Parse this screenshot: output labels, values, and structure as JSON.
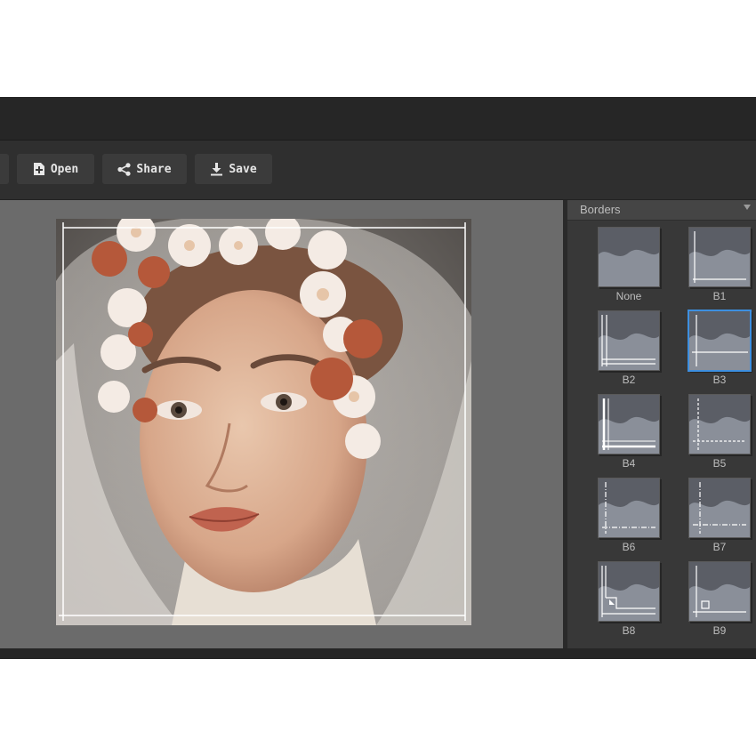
{
  "toolbar": {
    "buttons": [
      {
        "label": "Open",
        "icon": "file-plus-icon"
      },
      {
        "label": "Share",
        "icon": "share-icon"
      },
      {
        "label": "Save",
        "icon": "download-icon"
      }
    ]
  },
  "canvas": {
    "image": "portrait-photo",
    "border_style": "B3"
  },
  "panel": {
    "title": "Borders",
    "items": [
      {
        "label": "None"
      },
      {
        "label": "B1"
      },
      {
        "label": "B2"
      },
      {
        "label": "B3",
        "selected": true
      },
      {
        "label": "B4"
      },
      {
        "label": "B5"
      },
      {
        "label": "B6"
      },
      {
        "label": "B7"
      },
      {
        "label": "B8"
      },
      {
        "label": "B9"
      }
    ]
  },
  "colors": {
    "accent": "#3d8fe0",
    "canvas_bg": "#6b6b6b",
    "panel_bg": "#383838"
  }
}
